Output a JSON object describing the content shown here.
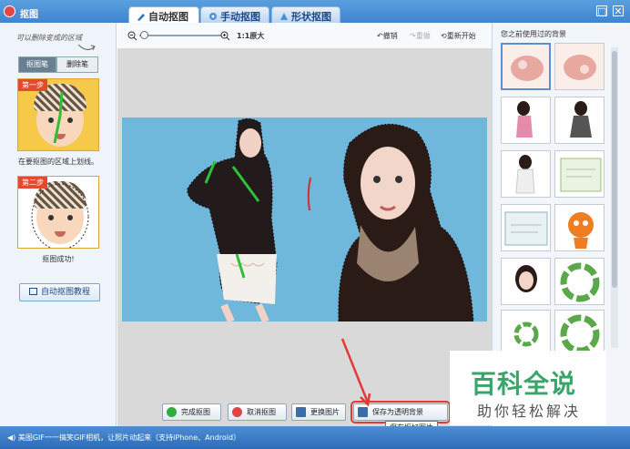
{
  "window": {
    "title": "抠图",
    "close_label": "✕",
    "restore_label": "□"
  },
  "tabs": [
    {
      "label": "自动抠图",
      "active": true
    },
    {
      "label": "手动抠图",
      "active": false
    },
    {
      "label": "形状抠图",
      "active": false
    }
  ],
  "left": {
    "hint": "可以删除变成的区域",
    "brush_label": "抠图笔",
    "erase_label": "删除笔",
    "step1_badge": "第一步",
    "step1_caption": "在要抠图的区域上划线。",
    "step2_badge": "第二步",
    "step2_caption": "抠图成功!",
    "tutorial_label": "自动抠图教程"
  },
  "toolbar": {
    "zoom_label": "1:1原大",
    "undo_label": "撤销",
    "redo_label": "重做",
    "restart_label": "重新开始"
  },
  "bottom": {
    "finish_label": "完成抠图",
    "cancel_label": "取消抠图",
    "replace_label": "更换图片",
    "save_label": "保存为透明背景",
    "tooltip": "保存抠好图片"
  },
  "right": {
    "title": "您之前使用过的背景"
  },
  "status": {
    "text": "美图GIF一一搞笑GIF相机，让照片动起来（支持iPhone、Android）"
  },
  "watermark": {
    "big": "百科全说",
    "small": "助你轻松解决"
  },
  "colors": {
    "accent": "#3f84cf",
    "highlight_box": "#e53935",
    "photo_bg": "#6fb8dc"
  }
}
